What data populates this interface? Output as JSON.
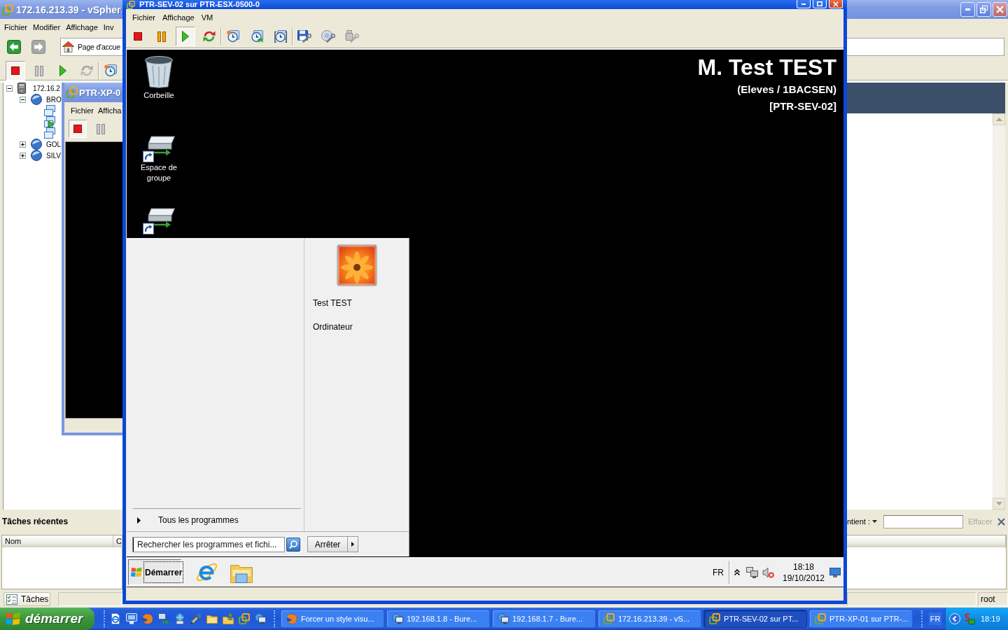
{
  "host_window": {
    "title": "172.16.213.39 - vSpher",
    "menu": [
      "Fichier",
      "Modifier",
      "Affichage",
      "Inv"
    ],
    "nav": {
      "back": {
        "disabled": false
      },
      "forward": {
        "disabled": true
      }
    },
    "address": "Page d'accue",
    "toolbar_groups": [
      [
        {
          "kind": "stop",
          "pressed": true,
          "disabled": false
        },
        {
          "kind": "pause",
          "pressed": false,
          "disabled": true
        },
        {
          "kind": "play",
          "pressed": false,
          "disabled": false
        },
        {
          "kind": "reset",
          "pressed": false,
          "disabled": true
        }
      ],
      [
        {
          "kind": "snapshot",
          "pressed": false,
          "disabled": false
        }
      ]
    ],
    "tree": [
      {
        "kind": "host",
        "label": "172.16.2",
        "expanded": true,
        "children": [
          {
            "kind": "pool",
            "label": "BRO",
            "expanded": true,
            "children": [
              {
                "kind": "vm",
                "running": false
              },
              {
                "kind": "vm",
                "running": true
              },
              {
                "kind": "vm",
                "running": false
              }
            ]
          },
          {
            "kind": "pool",
            "label": "GOL",
            "expanded": false
          },
          {
            "kind": "pool",
            "label": "SILV",
            "expanded": false
          }
        ]
      }
    ],
    "recent_tasks": {
      "title": "Tâches récentes",
      "filter_label": "ntient :",
      "clear_button": "Effacer",
      "clear_disabled": true,
      "columns": [
        "Nom",
        "C"
      ]
    },
    "status_bar": {
      "tasks_button": "Tâches",
      "user": "root"
    }
  },
  "xp_window": {
    "title": "PTR-XP-0",
    "menu": [
      "Fichier",
      "Afficha"
    ],
    "toolbar_groups": [
      [
        {
          "kind": "stop",
          "pressed": true,
          "disabled": false
        },
        {
          "kind": "pause",
          "pressed": false,
          "disabled": true
        }
      ]
    ]
  },
  "console_window": {
    "title": "PTR-SEV-02 sur PTR-ESX-0500-0",
    "menu": [
      "Fichier",
      "Affichage",
      "VM"
    ],
    "toolbar_groups": [
      [
        {
          "kind": "stop",
          "pressed": false,
          "disabled": false
        },
        {
          "kind": "pause",
          "pressed": false,
          "disabled": false
        },
        {
          "kind": "play",
          "pressed": true,
          "disabled": false
        },
        {
          "kind": "reset",
          "pressed": false,
          "disabled": false
        }
      ],
      [
        {
          "kind": "snapshot",
          "pressed": false,
          "disabled": false
        },
        {
          "kind": "revert",
          "pressed": false,
          "disabled": false
        },
        {
          "kind": "manage",
          "pressed": false,
          "disabled": false
        }
      ],
      [
        {
          "kind": "floppy",
          "pressed": false,
          "disabled": false
        },
        {
          "kind": "cd",
          "pressed": false,
          "disabled": false
        },
        {
          "kind": "usb",
          "pressed": false,
          "disabled": true
        }
      ]
    ]
  },
  "guest": {
    "desktop_icons": [
      {
        "kind": "trash",
        "label": "Corbeille"
      },
      {
        "kind": "network-drive",
        "label": "Espace de groupe"
      },
      {
        "kind": "network-drive"
      }
    ],
    "session_info": {
      "user": "M. Test TEST",
      "group": "(Eleves / 1BACSEN)",
      "machine": "[PTR-SEV-02]"
    },
    "start_menu": {
      "all_programs": "Tous les programmes",
      "user_links": [
        "Test TEST",
        "Ordinateur"
      ],
      "search": {
        "placeholder": "Rechercher les programmes et fichi..."
      },
      "shutdown": "Arrêter"
    },
    "taskbar": {
      "start": "Démarrer",
      "pinned": [
        {
          "kind": "browser"
        },
        {
          "kind": "explorer"
        }
      ],
      "language": "FR",
      "sound_muted": true,
      "time": "18:18",
      "date": "19/10/2012"
    }
  },
  "taskbar": {
    "start": "démarrer",
    "quick_launch": [
      {
        "kind": "page"
      },
      {
        "kind": "monitor"
      },
      {
        "kind": "globe"
      },
      {
        "kind": "transfer"
      },
      {
        "kind": "network"
      },
      {
        "kind": "tools"
      },
      {
        "kind": "folder"
      },
      {
        "kind": "shared-folder"
      },
      {
        "kind": "linked"
      },
      {
        "kind": "remote"
      }
    ],
    "tasks": [
      {
        "kind": "globe",
        "label": "Forcer un style visu...",
        "selected": false
      },
      {
        "kind": "remote",
        "label": "192.168.1.8 - Bure...",
        "selected": false
      },
      {
        "kind": "remote",
        "label": "192.168.1.7 - Bure...",
        "selected": false
      },
      {
        "kind": "linked",
        "label": "172.16.213.39 - vS...",
        "selected": false
      },
      {
        "kind": "linked",
        "label": "PTR-SEV-02 sur PT...",
        "selected": true
      },
      {
        "kind": "linked",
        "label": "PTR-XP-01 sur PTR-...",
        "selected": false
      }
    ],
    "language": "FR",
    "time": "18:19"
  }
}
